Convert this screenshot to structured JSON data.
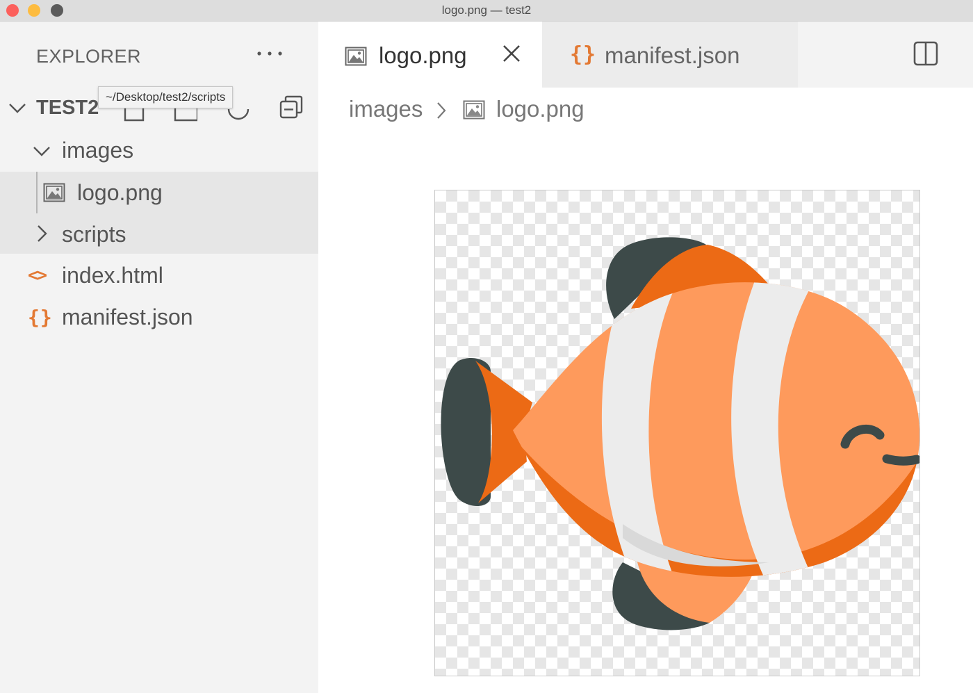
{
  "window": {
    "title": "logo.png — test2"
  },
  "sidebar": {
    "title": "EXPLORER",
    "more_icon": "ellipsis-icon",
    "root": {
      "label": "TEST2",
      "tooltip": "~/Desktop/test2/scripts",
      "actions": [
        "new-file-icon",
        "new-folder-icon",
        "refresh-icon",
        "collapse-all-icon"
      ]
    },
    "tree": [
      {
        "label": "images",
        "type": "folder",
        "expanded": true,
        "icon": "chevron-down-icon"
      },
      {
        "label": "logo.png",
        "type": "file",
        "icon": "image-file-icon",
        "selected": true
      },
      {
        "label": "scripts",
        "type": "folder",
        "expanded": false,
        "icon": "chevron-right-icon"
      },
      {
        "label": "index.html",
        "type": "file",
        "icon": "html-file-icon",
        "glyph": "<>"
      },
      {
        "label": "manifest.json",
        "type": "file",
        "icon": "json-file-icon",
        "glyph": "{}"
      }
    ]
  },
  "editor": {
    "tabs": [
      {
        "label": "logo.png",
        "icon": "image-file-icon",
        "active": true,
        "close_icon": "close-icon"
      },
      {
        "label": "manifest.json",
        "icon": "json-file-icon",
        "glyph": "{}",
        "active": false
      }
    ],
    "split_icon": "split-editor-icon",
    "breadcrumb": [
      "images",
      "logo.png"
    ],
    "preview": {
      "subject": "clownfish-logo",
      "background": "transparency-checkerboard"
    }
  },
  "colors": {
    "accent_orange": "#e37933",
    "fish_body": "#fe9a5c",
    "fish_dark_orange": "#ec6a15",
    "fish_stripe": "#ececec",
    "fish_fin": "#3d4a49",
    "sidebar_bg": "#f3f3f3",
    "selection_bg": "#e6e6e6"
  }
}
